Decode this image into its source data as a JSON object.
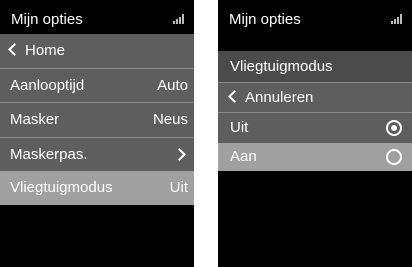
{
  "left_screen": {
    "title": "Mijn opties",
    "signal_icon": "signal-bars-icon",
    "back_item": {
      "label": "Home",
      "icon": "chevron-left-icon"
    },
    "items": [
      {
        "label": "Aanlooptijd",
        "value": "Auto"
      },
      {
        "label": "Masker",
        "value": "Neus"
      },
      {
        "label": "Maskerpas.",
        "icon": "chevron-right-icon"
      },
      {
        "label": "Vliegtuigmodus",
        "value": "Uit",
        "selected": true
      }
    ]
  },
  "right_screen": {
    "title": "Mijn opties",
    "signal_icon": "signal-bars-icon",
    "header": "Vliegtuigmodus",
    "cancel_item": {
      "label": "Annuleren",
      "icon": "chevron-left-icon"
    },
    "options": [
      {
        "label": "Uit",
        "checked": true
      },
      {
        "label": "Aan",
        "checked": false,
        "highlighted": true
      }
    ]
  },
  "colors": {
    "screen_bg": "#000000",
    "row_grey": "#5e5e5e",
    "row_dark": "#4b4b4b",
    "row_highlight": "#a0a0a0",
    "text": "#ffffff"
  }
}
